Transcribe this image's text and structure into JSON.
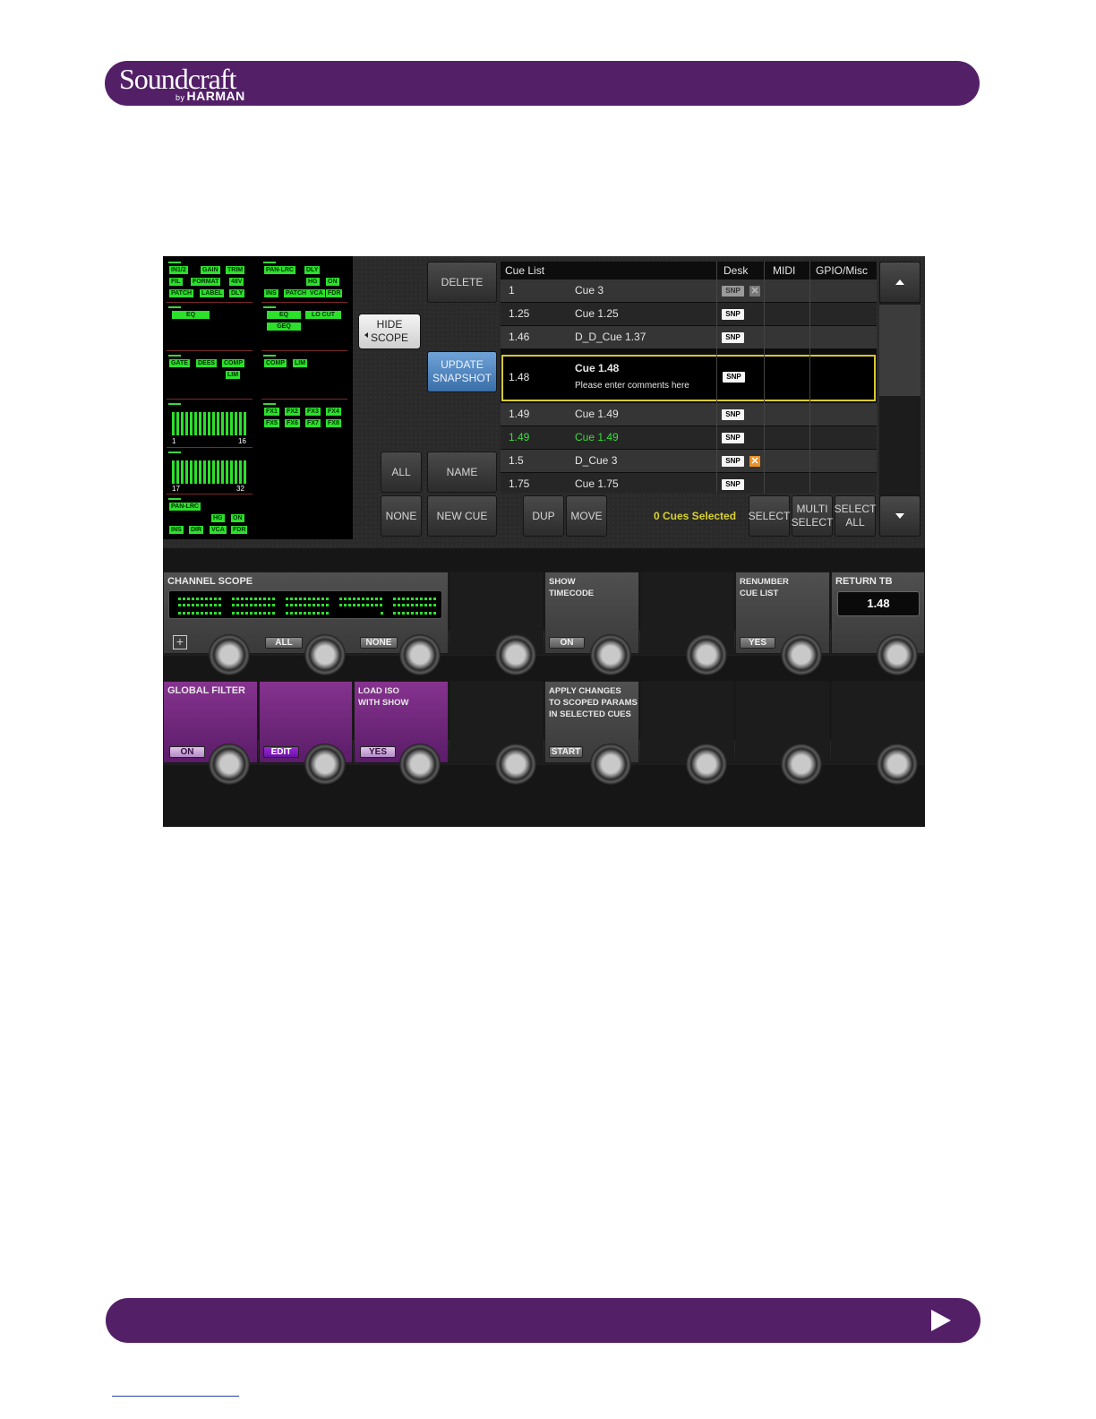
{
  "brand": {
    "name": "Soundcraft",
    "by": "by",
    "parent": "HARMAN"
  },
  "scope_tags": {
    "c1": [
      "IN1/2",
      "GAIN",
      "TRIM",
      "FIL",
      "FORMAT",
      "48V",
      "PATCH",
      "LABEL",
      "DLY"
    ],
    "c1_eq": "EQ",
    "c1_dyn": [
      "GATE",
      "DEES",
      "COMP",
      "LIM"
    ],
    "c1_bars": [
      {
        "from": "1",
        "to": "16"
      },
      {
        "from": "17",
        "to": "32"
      }
    ],
    "c1_pan": [
      "PAN-LRC",
      "HG",
      "ON",
      "INS",
      "DIR",
      "VCA",
      "FDR"
    ],
    "c2": [
      "PAN-LRC",
      "DLY",
      "HG",
      "ON",
      "INS",
      "PATCH",
      "VCA",
      "FDR"
    ],
    "c2_eq": [
      "EQ",
      "LO CUT",
      "GEQ"
    ],
    "c2_dyn": [
      "COMP",
      "LIM"
    ],
    "c2_fx": [
      "FX1",
      "FX2",
      "FX3",
      "FX4",
      "FX5",
      "FX6",
      "FX7",
      "FX8"
    ]
  },
  "buttons": {
    "hide_scope": [
      "HIDE",
      "SCOPE"
    ],
    "delete": "DELETE",
    "update_snapshot": [
      "UPDATE",
      "SNAPSHOT"
    ],
    "all": "ALL",
    "name": "NAME",
    "none": "NONE",
    "new_cue": "NEW CUE",
    "dup": "DUP",
    "move": "MOVE",
    "select": "SELECT",
    "multi_select": [
      "MULTI",
      "SELECT"
    ],
    "select_all": [
      "SELECT",
      "ALL"
    ]
  },
  "cue_table": {
    "headers": [
      "Cue List",
      "Desk",
      "MIDI",
      "GPIO/Misc"
    ],
    "snp_label": "SNP",
    "x_mark": "✕",
    "rows": [
      {
        "num": "1",
        "name": "Cue 3",
        "snp": "grey",
        "x": "grey"
      },
      {
        "num": "1.25",
        "name": "Cue 1.25",
        "snp": "white",
        "x": ""
      },
      {
        "num": "1.46",
        "name": "D_D_Cue 1.37",
        "snp": "white",
        "x": ""
      },
      {
        "num": "1.48",
        "name": "Cue 1.48",
        "comment": "Please enter comments here",
        "snp": "white",
        "x": "",
        "selected": true
      },
      {
        "num": "1.49",
        "name": "Cue 1.49",
        "snp": "white",
        "x": ""
      },
      {
        "num": "1.49",
        "name": "Cue 1.49",
        "snp": "white",
        "x": "",
        "green": true
      },
      {
        "num": "1.5",
        "name": "D_Cue 3",
        "snp": "white",
        "x": "orange"
      },
      {
        "num": "1.75",
        "name": "Cue 1.75",
        "snp": "white",
        "x": ""
      }
    ],
    "status": "0 Cues Selected"
  },
  "panels": {
    "channel_scope": "CHANNEL SCOPE",
    "scope_all": "ALL",
    "scope_none": "NONE",
    "show_timecode": [
      "SHOW",
      "TIMECODE"
    ],
    "timecode_on": "ON",
    "renumber": [
      "RENUMBER",
      "CUE LIST"
    ],
    "renumber_yes": "YES",
    "return_tb": "RETURN TB",
    "return_tb_value": "1.48",
    "global_filter": "GLOBAL FILTER",
    "global_on": "ON",
    "edit": "EDIT",
    "load_iso": [
      "LOAD ISO",
      "WITH SHOW"
    ],
    "load_iso_yes": "YES",
    "apply_changes": [
      "APPLY CHANGES",
      "TO SCOPED PARAMS",
      "IN SELECTED CUES"
    ],
    "apply_start": "START"
  },
  "colors": {
    "banner": "#532068",
    "scope_green": "#2ce02c",
    "selection_border": "#d8c92e",
    "status_yellow": "#d8d22e",
    "filter_purple": "#86338f"
  }
}
